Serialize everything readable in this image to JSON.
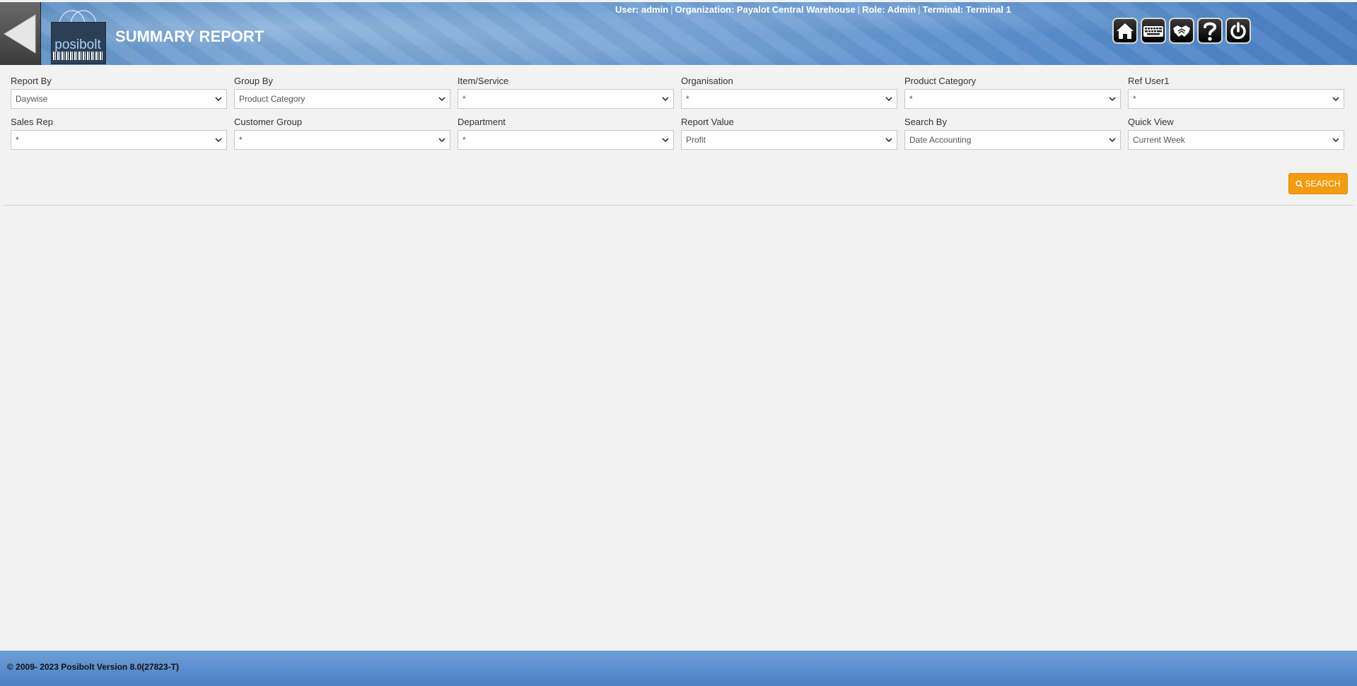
{
  "header": {
    "logo_text": "posibolt",
    "title": "SUMMARY REPORT",
    "user_info": {
      "user": "User: admin",
      "organization": "Organization: Payalot Central Warehouse",
      "role": "Role: Admin",
      "terminal": "Terminal: Terminal 1",
      "separator": "|"
    },
    "toolbar_icons": [
      "home-icon",
      "keyboard-icon",
      "handshake-icon",
      "help-icon",
      "power-icon"
    ]
  },
  "filters": {
    "report_by": {
      "label": "Report By",
      "value": "Daywise"
    },
    "group_by": {
      "label": "Group By",
      "value": "Product Category"
    },
    "item_service": {
      "label": "Item/Service",
      "value": "*"
    },
    "organisation": {
      "label": "Organisation",
      "value": "*"
    },
    "product_category": {
      "label": "Product Category",
      "value": "*"
    },
    "ref_user1": {
      "label": "Ref User1",
      "value": "*"
    },
    "sales_rep": {
      "label": "Sales Rep",
      "value": "*"
    },
    "customer_group": {
      "label": "Customer Group",
      "value": "*"
    },
    "department": {
      "label": "Department",
      "value": "*"
    },
    "report_value": {
      "label": "Report Value",
      "value": "Profit"
    },
    "search_by": {
      "label": "Search By",
      "value": "Date Accounting"
    },
    "quick_view": {
      "label": "Quick View",
      "value": "Current Week"
    }
  },
  "actions": {
    "search_label": "SEARCH"
  },
  "footer": {
    "copyright": "© 2009- 2023 Posibolt Version  8.0(27823-T)"
  },
  "colors": {
    "header_blue": "#5e92cf",
    "search_orange": "#f39c12",
    "background": "#f2f2f2"
  }
}
